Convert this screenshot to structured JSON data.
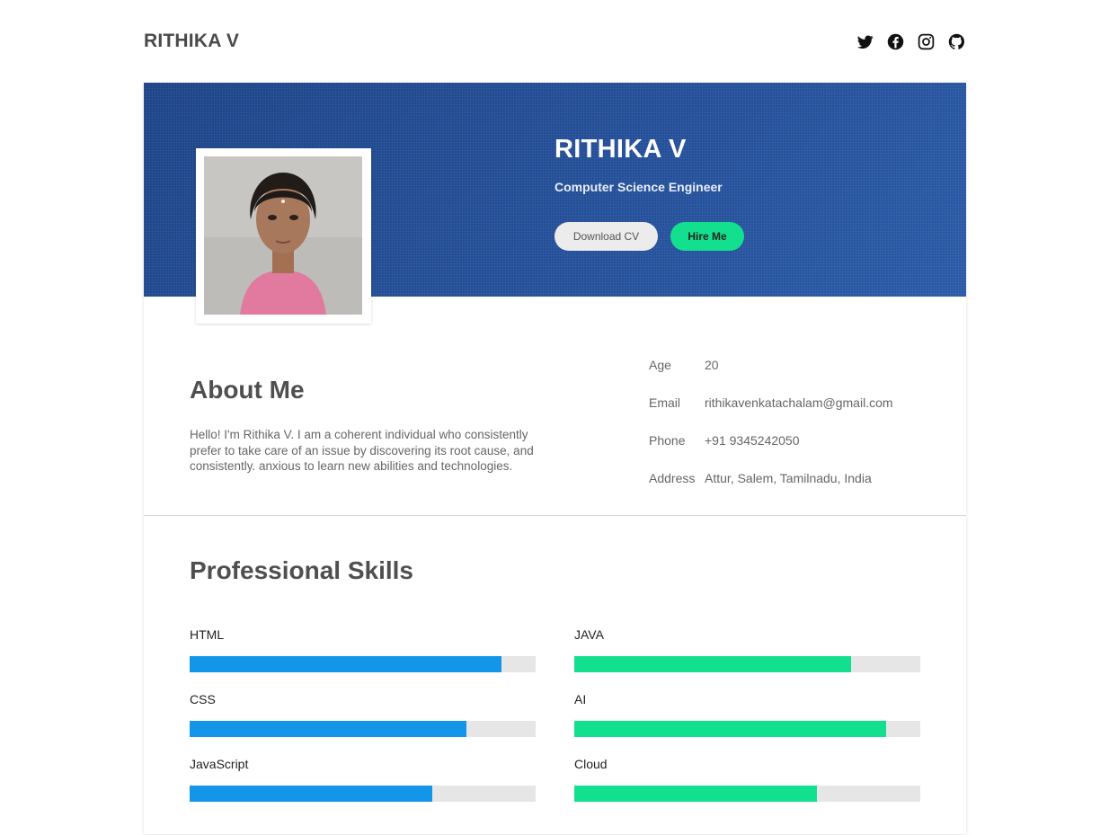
{
  "header": {
    "brand": "RITHIKA V",
    "socials": [
      "twitter-icon",
      "facebook-icon",
      "instagram-icon",
      "github-icon"
    ]
  },
  "hero": {
    "name": "RITHIKA V",
    "role": "Computer Science Engineer",
    "download_label": "Download CV",
    "hire_label": "Hire Me",
    "bg_color": "#1f4890"
  },
  "about": {
    "title": "About Me",
    "text": "Hello! I'm Rithika V. I am a coherent individual who consistently prefer to take care of an issue by discovering its root cause, and consistently. anxious to learn new abilities and technologies."
  },
  "info": [
    {
      "key": "Age",
      "value": "20"
    },
    {
      "key": "Email",
      "value": "rithikavenkatachalam@gmail.com"
    },
    {
      "key": "Phone",
      "value": "+91 9345242050"
    },
    {
      "key": "Address",
      "value": "Attur, Salem, Tamilnadu, India"
    }
  ],
  "skills": {
    "title": "Professional Skills",
    "left_color": "#1496e8",
    "right_color": "#13e08f",
    "items": [
      {
        "name": "HTML",
        "level": 0.9
      },
      {
        "name": "JAVA",
        "level": 0.8
      },
      {
        "name": "CSS",
        "level": 0.8
      },
      {
        "name": "AI",
        "level": 0.9
      },
      {
        "name": "JavaScript",
        "level": 0.7
      },
      {
        "name": "Cloud",
        "level": 0.7
      }
    ]
  }
}
